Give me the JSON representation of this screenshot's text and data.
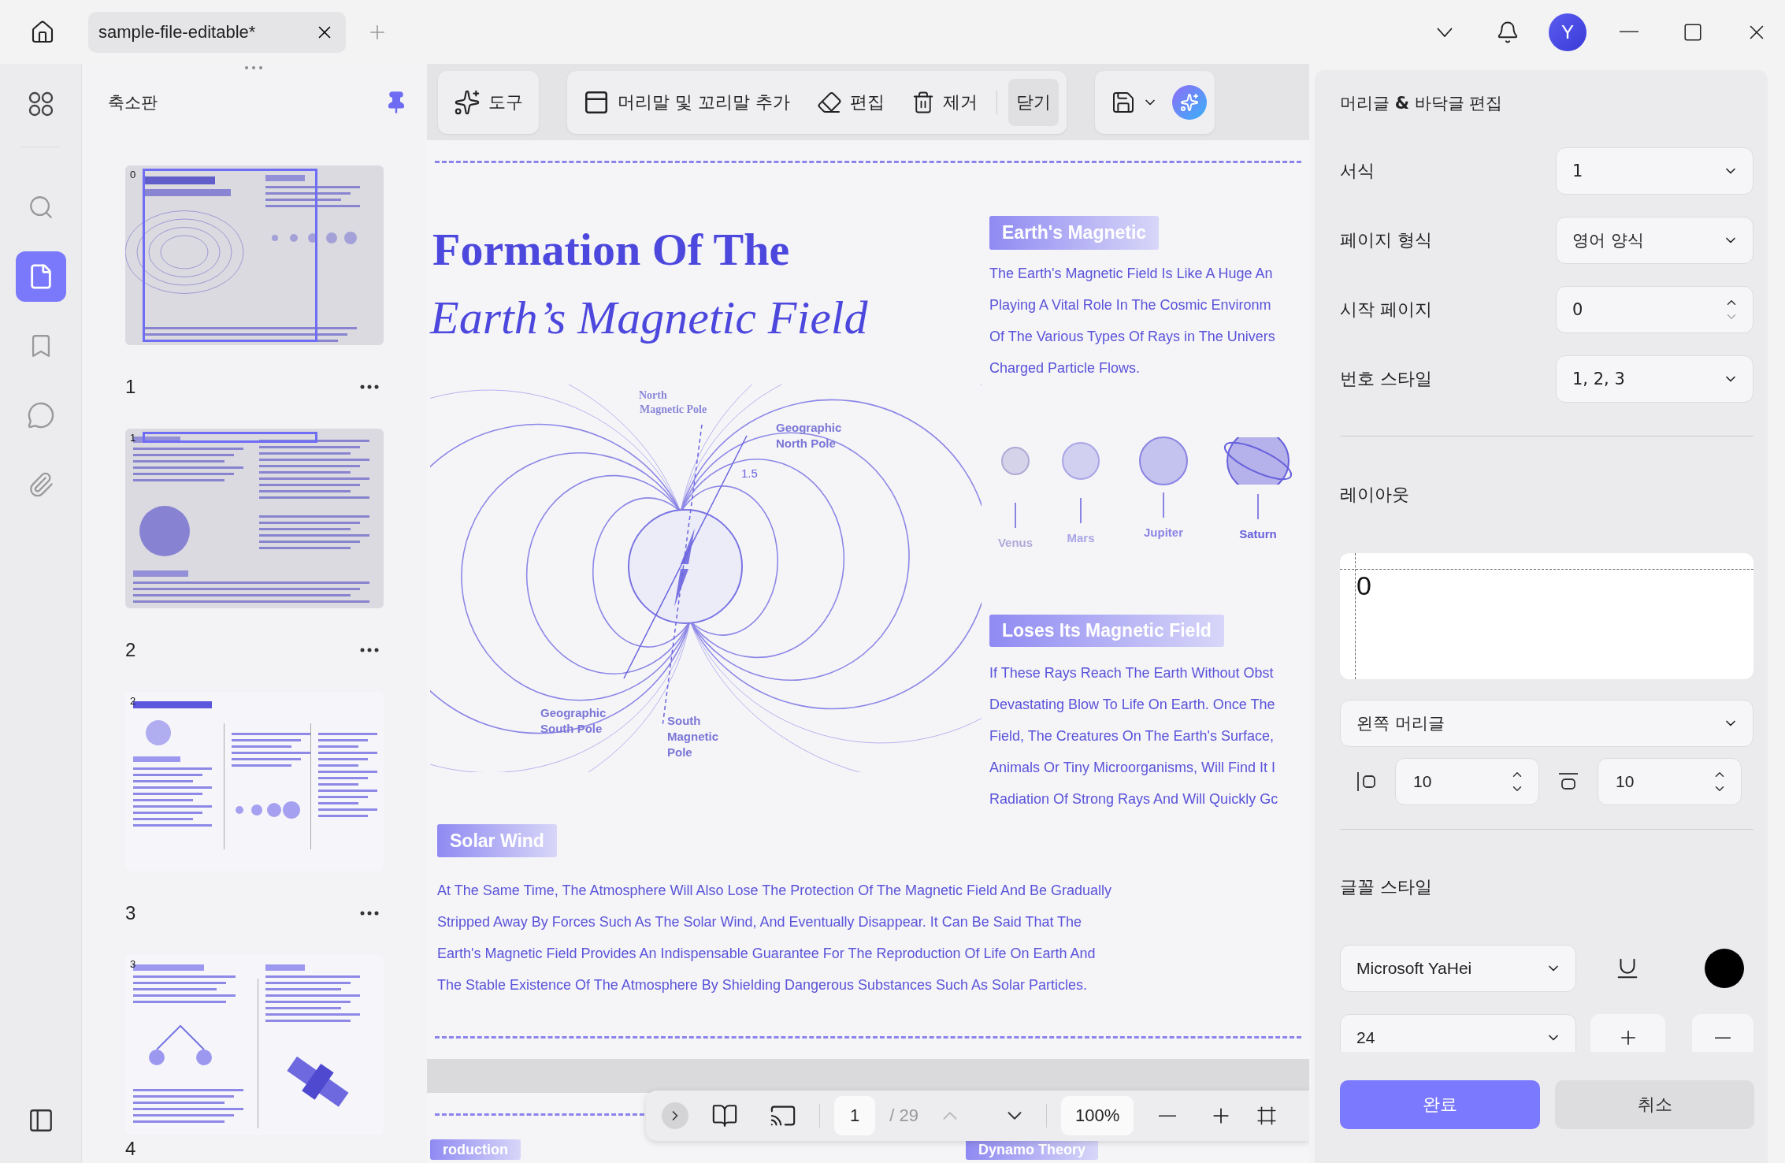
{
  "tab": {
    "title": "sample-file-editable*"
  },
  "avatar": "Y",
  "sidebar": {
    "items": [
      {
        "kind": "apps",
        "selected": false
      },
      {
        "kind": "search",
        "selected": false
      },
      {
        "kind": "pages",
        "selected": true
      },
      {
        "kind": "bookmark",
        "selected": false
      },
      {
        "kind": "comment",
        "selected": false
      },
      {
        "kind": "attachment",
        "selected": false
      }
    ]
  },
  "thumbnails": {
    "title": "축소판",
    "pages": [
      {
        "label": "1",
        "index": "0",
        "kind": "title",
        "in_view": true,
        "dimmed": true,
        "menu": true
      },
      {
        "label": "2",
        "index": "1",
        "kind": "core",
        "in_view": true,
        "dimmed": true,
        "menu": true
      },
      {
        "label": "3",
        "index": "2",
        "kind": "evidence",
        "in_view": false,
        "dimmed": false,
        "menu": true
      },
      {
        "label": "4",
        "index": "3",
        "kind": "future",
        "in_view": false,
        "dimmed": false,
        "menu": false
      }
    ]
  },
  "toolbar": {
    "tools": "도구",
    "actions": [
      {
        "label": "머리말 및 꼬리말 추가",
        "kind": "header"
      },
      {
        "label": "편집",
        "kind": "edit"
      },
      {
        "label": "제거",
        "kind": "remove"
      }
    ],
    "close": "닫기"
  },
  "document": {
    "title_lines": [
      "Formation Of The",
      "Earth’s Magnetic Field"
    ],
    "diagram_labels": [
      {
        "text": "North",
        "kind": "serif"
      },
      {
        "text": "Magnetic Pole",
        "kind": "serif"
      },
      {
        "text": "Geographic",
        "kind": "sans"
      },
      {
        "text": "North Pole",
        "kind": "sans"
      },
      {
        "text": "1.5",
        "kind": "angle"
      },
      {
        "text": "Geographic",
        "kind": "sans"
      },
      {
        "text": "South Pole",
        "kind": "sans"
      },
      {
        "text": "South",
        "kind": "sans"
      },
      {
        "text": "Magnetic",
        "kind": "sans"
      },
      {
        "text": "Pole",
        "kind": "sans"
      }
    ],
    "sections": [
      {
        "heading": "Earth's Magnetic",
        "lines": [
          "The Earth's Magnetic Field Is Like A Huge An",
          "Playing A Vital Role In The Cosmic Environm",
          "Of The Various Types Of Rays in The Univers",
          "Charged Particle Flows."
        ]
      },
      {
        "heading": "Loses Its Magnetic Field",
        "lines": [
          "If These Rays Reach The Earth Without Obst",
          "Devastating Blow To Life On Earth. Once The",
          "Field, The Creatures On The Earth's Surface,",
          "Animals Or Tiny Microorganisms, Will Find It I",
          "Radiation Of Strong Rays And Will Quickly Gc"
        ]
      }
    ],
    "planets": [
      {
        "name": "Venus",
        "color": "#aeaad6"
      },
      {
        "name": "Mars",
        "color": "#a9a5e6"
      },
      {
        "name": "Jupiter",
        "color": "#8a84e3"
      },
      {
        "name": "Saturn",
        "color": "#6760dc"
      }
    ],
    "solar": {
      "heading": "Solar Wind",
      "lines": [
        "At The Same Time, The Atmosphere Will Also Lose The Protection Of The Magnetic Field And Be Gradually",
        "Stripped Away By Forces Such As The Solar Wind, And Eventually Disappear. It Can Be Said That The",
        "Earth's Magnetic Field Provides An Indispensable Guarantee For The Reproduction Of Life On Earth And",
        "The Stable Existence Of The Atmosphere By Shielding Dangerous Substances Such As Solar Particles."
      ]
    },
    "next_headings": [
      "roduction",
      "Dynamo Theory"
    ]
  },
  "bottom_bar": {
    "page": "1",
    "total": "/ 29",
    "zoom": "100%",
    "prev": {
      "disabled": true
    },
    "next": {
      "disabled": false
    }
  },
  "panel": {
    "title": "머리글 **&** 바닥글 편집",
    "fields": [
      {
        "label": "서식",
        "value": "1",
        "kind": "select"
      },
      {
        "label": "페이지 형식",
        "value": "영어 양식",
        "kind": "select"
      },
      {
        "label": "시작 페이지",
        "value": "0",
        "kind": "spin"
      },
      {
        "label": "번호 스타일",
        "value": "1, 2, 3",
        "kind": "select"
      }
    ],
    "layout": {
      "title": "레이아웃",
      "preview": "0",
      "position": "왼쪽 머리글",
      "margins": [
        {
          "kind": "left",
          "value": "10"
        },
        {
          "kind": "top",
          "value": "10"
        }
      ]
    },
    "font": {
      "title": "글꼴 스타일",
      "family": "Microsoft YaHei",
      "size": "24",
      "color": "#000000"
    },
    "ok": "완료",
    "cancel": "취소"
  }
}
